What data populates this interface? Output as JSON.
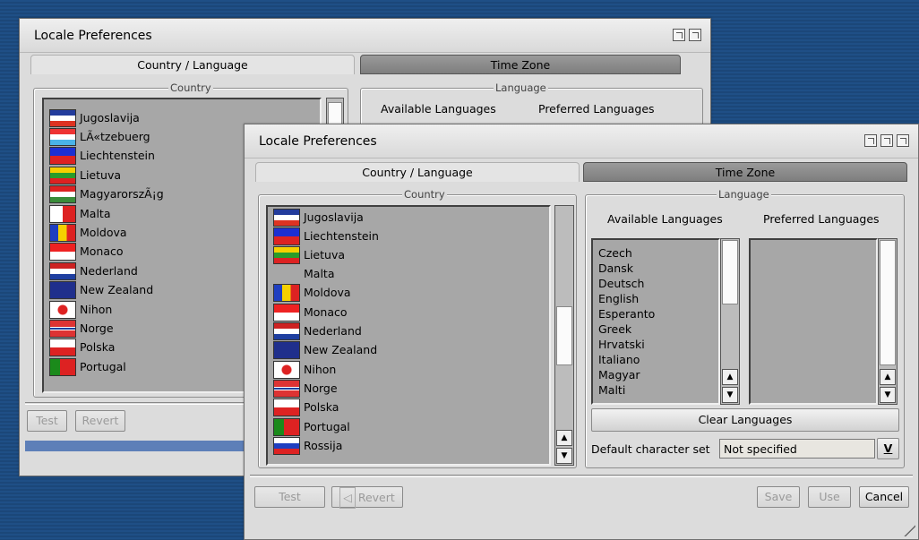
{
  "back_window": {
    "title": "Locale Preferences",
    "tabs": [
      "Country / Language",
      "Time Zone"
    ],
    "country_legend": "Country",
    "language_legend": "Language",
    "available_label": "Available Languages",
    "preferred_label": "Preferred Languages",
    "countries": [
      "Jugoslavija",
      "LÃ«tzebuerg",
      "Liechtenstein",
      "Lietuva",
      "MagyarorszÃ¡g",
      "Malta",
      "Moldova",
      "Monaco",
      "Nederland",
      "New Zealand",
      "Nihon",
      "Norge",
      "Polska",
      "Portugal"
    ],
    "buttons": {
      "test": "Test",
      "revert": "Revert"
    }
  },
  "front_window": {
    "title": "Locale Preferences",
    "tabs": [
      "Country / Language",
      "Time Zone"
    ],
    "country_legend": "Country",
    "language_legend": "Language",
    "available_label": "Available Languages",
    "preferred_label": "Preferred Languages",
    "countries": [
      "Jugoslavija",
      "Liechtenstein",
      "Lietuva",
      "Malta",
      "Moldova",
      "Monaco",
      "Nederland",
      "New Zealand",
      "Nihon",
      "Norge",
      "Polska",
      "Portugal",
      "Rossija"
    ],
    "available_languages": [
      "Czech",
      "Dansk",
      "Deutsch",
      "English",
      "Esperanto",
      "Greek",
      "Hrvatski",
      "Italiano",
      "Magyar",
      "Malti"
    ],
    "clear_languages": "Clear Languages",
    "charset_label": "Default character set",
    "charset_value": "Not specified",
    "charset_arrow": "V",
    "buttons": {
      "test": "Test",
      "revert": "Revert",
      "save": "Save",
      "use": "Use",
      "cancel": "Cancel"
    }
  }
}
